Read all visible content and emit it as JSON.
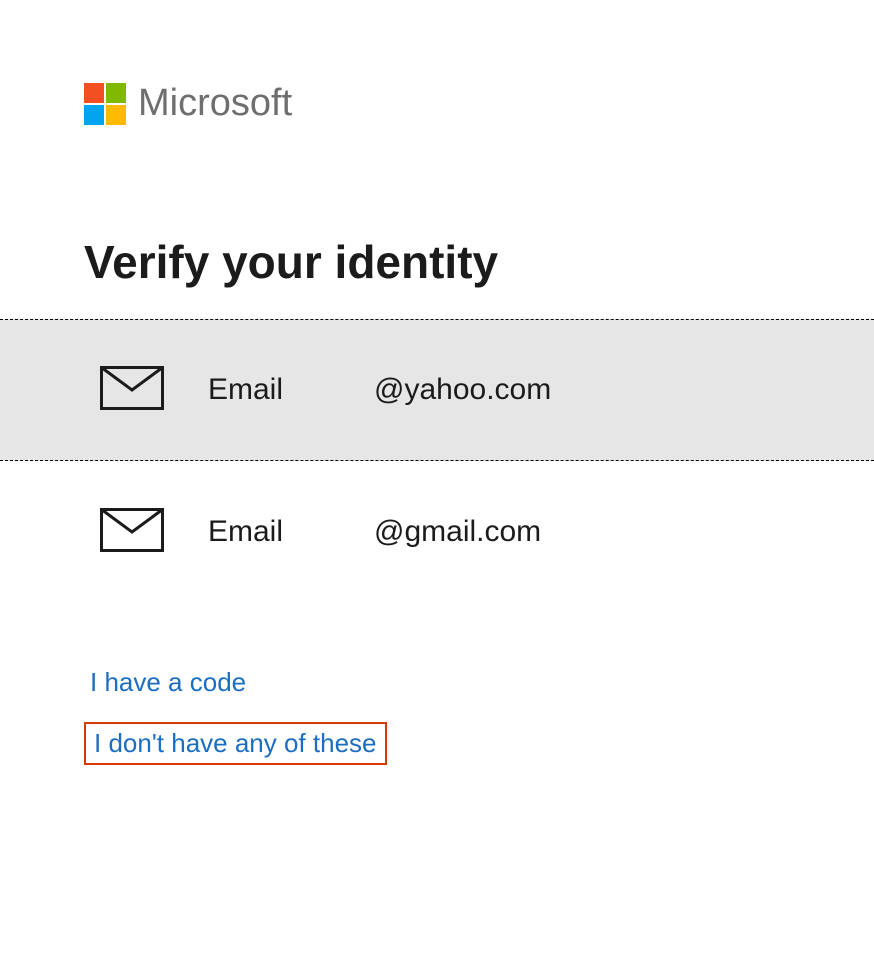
{
  "brand": "Microsoft",
  "heading": "Verify your identity",
  "options": [
    {
      "label": "Email",
      "domain": "@yahoo.com"
    },
    {
      "label": "Email",
      "domain": "@gmail.com"
    }
  ],
  "links": {
    "have_code": "I have a code",
    "dont_have": "I don't have any of these"
  }
}
